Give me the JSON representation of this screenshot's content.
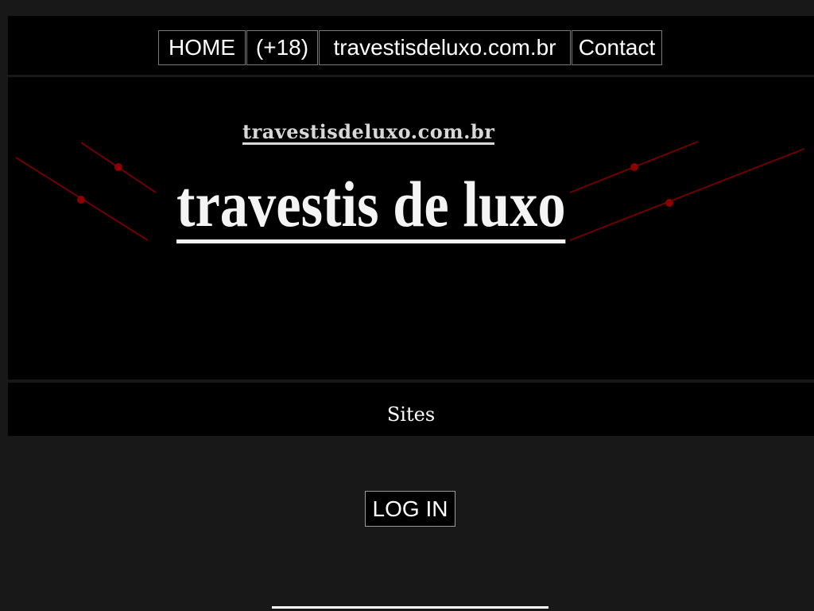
{
  "nav": {
    "items": [
      {
        "label": "HOME"
      },
      {
        "label": "(+18)"
      },
      {
        "label": "travestisdeluxo.com.br"
      },
      {
        "label": "Contact"
      }
    ]
  },
  "banner": {
    "subtitle": "travestisdeluxo.com.br",
    "title": "travestis de luxo"
  },
  "sites": {
    "label": "Sites"
  },
  "auth": {
    "login_label": "LOG IN"
  },
  "colors": {
    "background": "#181818",
    "panel": "#000000",
    "accent_lines": "#8b0000",
    "text": "#ffffff"
  }
}
